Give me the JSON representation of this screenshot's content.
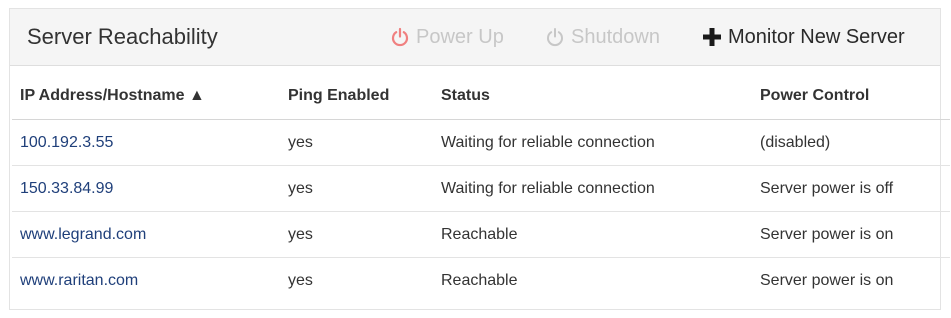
{
  "header": {
    "title": "Server Reachability",
    "power_up_label": "Power Up",
    "shutdown_label": "Shutdown",
    "monitor_label": "Monitor New Server"
  },
  "table": {
    "columns": [
      "IP Address/Hostname ▲",
      "Ping Enabled",
      "Status",
      "Power Control"
    ],
    "rows": [
      {
        "host": "100.192.3.55",
        "ping": "yes",
        "status": "Waiting for reliable connection",
        "power": "(disabled)"
      },
      {
        "host": "150.33.84.99",
        "ping": "yes",
        "status": "Waiting for reliable connection",
        "power": "Server power is off"
      },
      {
        "host": "www.legrand.com",
        "ping": "yes",
        "status": "Reachable",
        "power": "Server power is on"
      },
      {
        "host": "www.raritan.com",
        "ping": "yes",
        "status": "Reachable",
        "power": "Server power is on"
      }
    ]
  },
  "colors": {
    "power_up_icon": "#f08080",
    "disabled_text": "#c7c7c7",
    "link": "#1f3f7a"
  },
  "icons": {
    "power_up": "power-icon",
    "shutdown": "power-icon",
    "monitor": "plus-icon",
    "sort": "sort-ascending-icon"
  }
}
